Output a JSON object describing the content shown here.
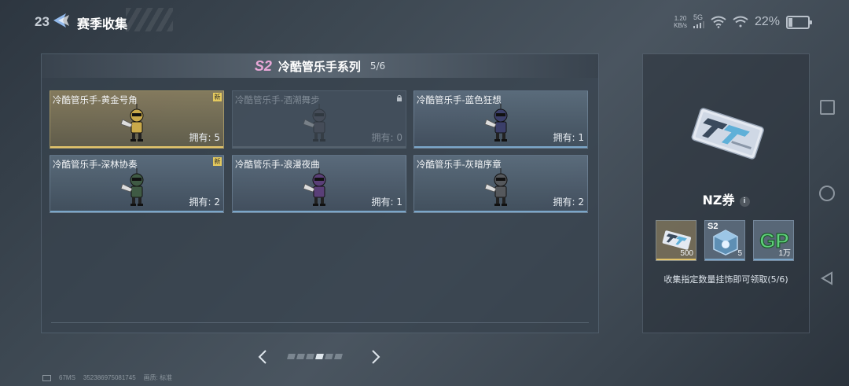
{
  "statusbar": {
    "time": "23",
    "net_speed": "1.20",
    "net_unit": "KB/s",
    "signal": "5G",
    "battery_pct": "22%"
  },
  "header": {
    "title": "赛季收集"
  },
  "series": {
    "badge": "S2",
    "title": "冷酷管乐手系列",
    "progress": "5/6"
  },
  "owned_label": "拥有:",
  "items": [
    {
      "name": "冷酷管乐手-黄金号角",
      "count": "5",
      "state": "gold",
      "new": "新",
      "color": "#c9a94a"
    },
    {
      "name": "冷酷管乐手-酒潮舞步",
      "count": "0",
      "state": "locked",
      "new": "",
      "color": "#4b4a55"
    },
    {
      "name": "冷酷管乐手-蓝色狂想",
      "count": "1",
      "state": "normal",
      "new": "",
      "color": "#3b3f6a"
    },
    {
      "name": "冷酷管乐手-深林协奏",
      "count": "2",
      "state": "normal",
      "new": "新",
      "color": "#3f5a44"
    },
    {
      "name": "冷酷管乐手-浪漫夜曲",
      "count": "1",
      "state": "normal",
      "new": "",
      "color": "#5a3f78"
    },
    {
      "name": "冷酷管乐手-灰暗序章",
      "count": "2",
      "state": "normal",
      "new": "",
      "color": "#55585c"
    }
  ],
  "pager": {
    "total": 6,
    "active": 3
  },
  "reward": {
    "name": "NZ券",
    "info": "i",
    "items": [
      {
        "icon": "ticket-icon",
        "qty": "500",
        "tag": ""
      },
      {
        "icon": "crate-icon",
        "qty": "5",
        "tag": "S2"
      },
      {
        "icon": "gp-icon",
        "qty": "1万",
        "tag": "GP"
      }
    ],
    "description": "收集指定数量挂饰即可领取(5/6)"
  },
  "footer": {
    "fps": "67MS",
    "id": "352386975081745",
    "quality_label": "画质:",
    "quality": "标准"
  }
}
